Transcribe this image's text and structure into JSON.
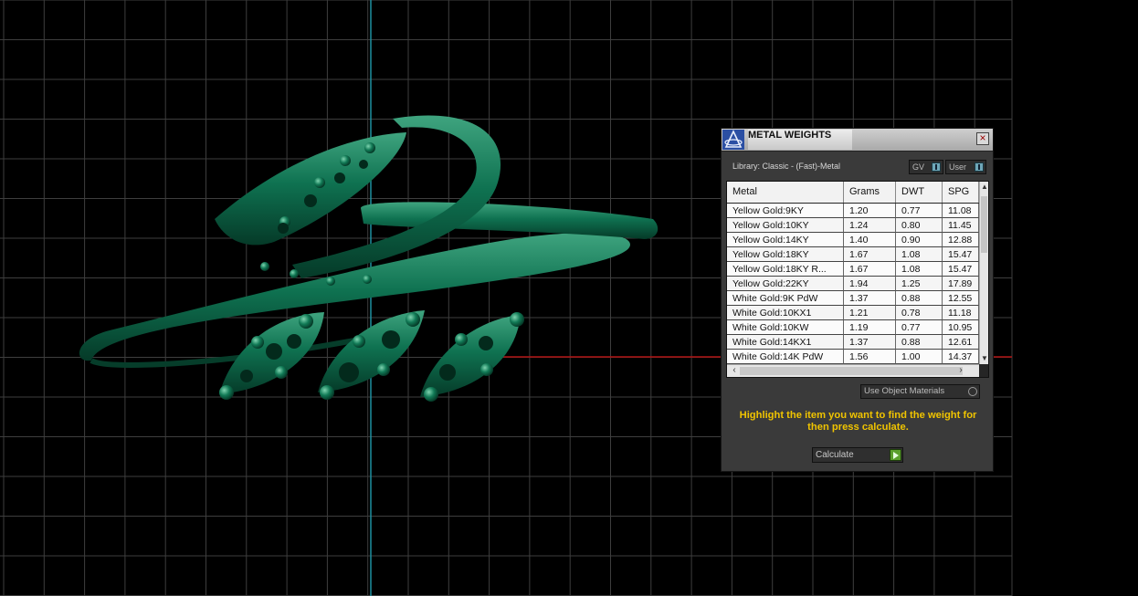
{
  "window": {
    "title": "METAL WEIGHTS",
    "close_label": "×"
  },
  "library": {
    "label": "Library: Classic - (Fast)-Metal"
  },
  "toggles": {
    "gv_label": "GV",
    "user_label": "User"
  },
  "table": {
    "columns": [
      "Metal",
      "Grams",
      "DWT",
      "SPG"
    ],
    "rows": [
      [
        "Yellow Gold:9KY",
        "1.20",
        "0.77",
        "11.08"
      ],
      [
        "Yellow Gold:10KY",
        "1.24",
        "0.80",
        "11.45"
      ],
      [
        "Yellow Gold:14KY",
        "1.40",
        "0.90",
        "12.88"
      ],
      [
        "Yellow Gold:18KY",
        "1.67",
        "1.08",
        "15.47"
      ],
      [
        "Yellow Gold:18KY R...",
        "1.67",
        "1.08",
        "15.47"
      ],
      [
        "Yellow Gold:22KY",
        "1.94",
        "1.25",
        "17.89"
      ],
      [
        "White Gold:9K PdW",
        "1.37",
        "0.88",
        "12.55"
      ],
      [
        "White Gold:10KX1",
        "1.21",
        "0.78",
        "11.18"
      ],
      [
        "White Gold:10KW",
        "1.19",
        "0.77",
        "10.95"
      ],
      [
        "White Gold:14KX1",
        "1.37",
        "0.88",
        "12.61"
      ],
      [
        "White Gold:14K PdW",
        "1.56",
        "1.00",
        "14.37"
      ]
    ]
  },
  "use_object_materials": {
    "label": "Use Object Materials"
  },
  "hint": {
    "text": "Highlight the item you want to find the weight for then press calculate."
  },
  "calculate": {
    "label": "Calculate"
  },
  "colors": {
    "model": "#0e6a4c",
    "axis_red": "#b01212",
    "axis_cyan": "#1e8fa0",
    "hint": "#f0c400"
  }
}
